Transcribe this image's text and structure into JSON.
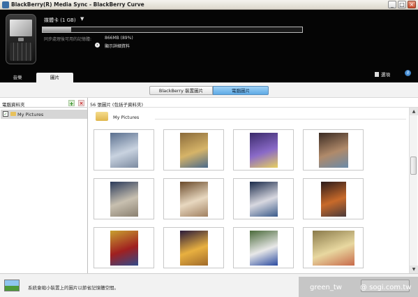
{
  "window": {
    "title": "BlackBerry(R) Media Sync - BlackBerry Curve",
    "controls": {
      "minimize": "_",
      "maximize": "□",
      "close": "×"
    }
  },
  "device": {
    "storage_label": "媒體卡 (1 GB)",
    "storage_fill_percent": 11,
    "sync_note": "同步處理後可用的記憶體:",
    "free_space": "866MB (89%)",
    "details_label": "顯示詳細資料"
  },
  "tabs": [
    {
      "label": "音樂"
    },
    {
      "label": "圖片"
    }
  ],
  "toolbar": {
    "options_label": "選項",
    "help_label": "?"
  },
  "view_toggle": {
    "device_label": "BlackBerry 裝置圖片",
    "computer_label": "電腦圖片"
  },
  "left_pane": {
    "title": "電腦資料夾",
    "folders": [
      {
        "name": "My Pictures",
        "checked": true
      }
    ]
  },
  "right_pane": {
    "count_label": "56 張圖片 (包括子資料夾)",
    "folder_name": "My Pictures",
    "thumbnails": [
      {
        "name": "boat-in-bay",
        "colors": [
          "#5a6f8e",
          "#c9d3e0",
          "#7b8aa0"
        ]
      },
      {
        "name": "street-art",
        "colors": [
          "#8a6a3a",
          "#d6b468",
          "#4a6a8a"
        ]
      },
      {
        "name": "purple-flower",
        "colors": [
          "#3a2a6a",
          "#8a6ac8",
          "#e8d060"
        ]
      },
      {
        "name": "fjord",
        "colors": [
          "#3a2a22",
          "#b08a6a",
          "#6a8aa8"
        ]
      },
      {
        "name": "desert-dunes",
        "colors": [
          "#2a3a5a",
          "#c8c0b0",
          "#8a8070"
        ]
      },
      {
        "name": "shells",
        "colors": [
          "#6a4a2a",
          "#e8d8c0",
          "#a08060"
        ]
      },
      {
        "name": "shuttle-launch",
        "colors": [
          "#1a2a4a",
          "#d8d8e0",
          "#3a5a8a"
        ]
      },
      {
        "name": "night-street",
        "colors": [
          "#2a1a1a",
          "#c86a2a",
          "#4a3a3a"
        ]
      },
      {
        "name": "cyclist",
        "colors": [
          "#c8a030",
          "#a02020",
          "#304a8a"
        ]
      },
      {
        "name": "eiffel-tower",
        "colors": [
          "#2a1a3a",
          "#e8b040",
          "#a06a2a"
        ]
      },
      {
        "name": "soccer",
        "colors": [
          "#4a6a3a",
          "#e8e8e8",
          "#2a4aa0"
        ]
      },
      {
        "name": "abstract-shape",
        "colors": [
          "#8a7a4a",
          "#e8d8a0",
          "#c86a4a"
        ]
      }
    ]
  },
  "status": {
    "message": "系統會縮小裝置上的圖片以節省記憶體空間。"
  },
  "watermark": {
    "user": "green_tw",
    "site": "@ sogi.com.tw"
  }
}
